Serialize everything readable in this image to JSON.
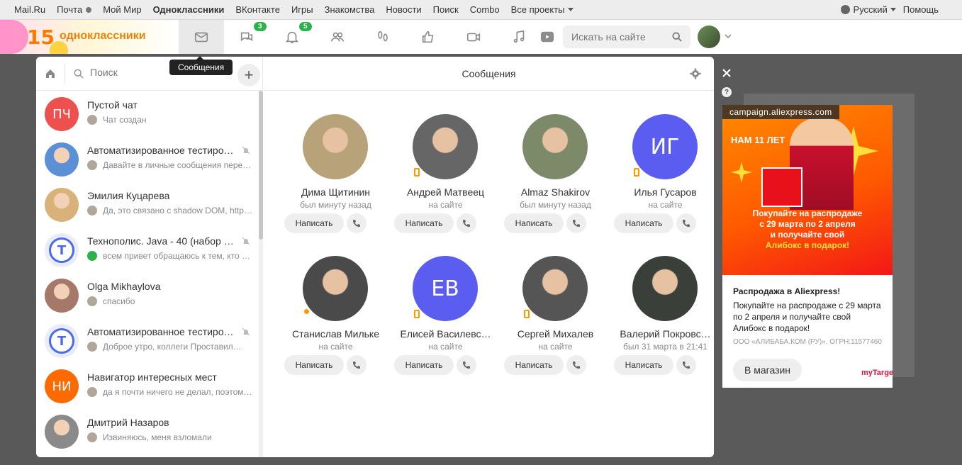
{
  "portal": {
    "links": [
      "Mail.Ru",
      "Почта",
      "Мой Мир",
      "Одноклассники",
      "ВКонтакте",
      "Игры",
      "Знакомства",
      "Новости",
      "Поиск",
      "Combo",
      "Все проекты"
    ],
    "language": "Русский",
    "help": "Помощь"
  },
  "logo": {
    "number": "15",
    "name": "одноклассники"
  },
  "toolbar": {
    "badges": {
      "discussions": "3",
      "notifications": "5"
    },
    "search_placeholder": "Искать на сайте"
  },
  "tooltip": "Сообщения",
  "sidebar": {
    "search_placeholder": "Поиск",
    "chats": [
      {
        "title": "Пустой чат",
        "sub": "Чат создан",
        "initials": "ПЧ",
        "color": "#ee4f4f",
        "muted": false
      },
      {
        "title": "Автоматизированное тестиро…",
        "sub": "Давайте в личные сообщения пере…",
        "initials": "",
        "color": "#5b8fd6",
        "muted": true
      },
      {
        "title": "Эмилия Куцарева",
        "sub": "Да, это связано с shadow DOM, https…",
        "initials": "",
        "color": "#d9b27a",
        "muted": false
      },
      {
        "title": "Технополис. Java - 40 (набор …",
        "sub": "всем привет обращаюсь к тем, кто …",
        "initials": "T",
        "color": "#4d6ae6",
        "muted": true
      },
      {
        "title": "Olga Mikhaylova",
        "sub": "спасибо",
        "initials": "",
        "color": "#a5786a",
        "muted": false
      },
      {
        "title": "Автоматизированное тестиро…",
        "sub": "Доброе утро, коллеги Проставил…",
        "initials": "T",
        "color": "#4d6ae6",
        "muted": true
      },
      {
        "title": "Навигатор интересных мест",
        "sub": "да я почти ничего не делал, поэтом…",
        "initials": "НИ",
        "color": "#ff6a00",
        "muted": false
      },
      {
        "title": "Дмитрий Назаров",
        "sub": "Извиняюсь, меня взломали",
        "initials": "",
        "color": "#8a8a8a",
        "muted": false
      }
    ]
  },
  "content": {
    "title": "Сообщения",
    "write_label": "Написать",
    "friends": [
      {
        "name": "Дима Щитинин",
        "status": "был минуту назад",
        "initials": "",
        "color": "#b7a27a",
        "indicator": "none"
      },
      {
        "name": "Андрей Матвеец",
        "status": "на сайте",
        "initials": "",
        "color": "#666666",
        "indicator": "phone"
      },
      {
        "name": "Almaz Shakirov",
        "status": "был минуту назад",
        "initials": "",
        "color": "#7c8a6a",
        "indicator": "none"
      },
      {
        "name": "Илья Гусаров",
        "status": "на сайте",
        "initials": "ИГ",
        "color": "#5b5cf0",
        "indicator": "phone"
      },
      {
        "name": "Станислав Мильке",
        "status": "на сайте",
        "initials": "",
        "color": "#4a4a4a",
        "indicator": "dot"
      },
      {
        "name": "Елисей Василевс…",
        "status": "на сайте",
        "initials": "ЕВ",
        "color": "#5b5cf0",
        "indicator": "phone"
      },
      {
        "name": "Сергей Михалев",
        "status": "на сайте",
        "initials": "",
        "color": "#555555",
        "indicator": "phone"
      },
      {
        "name": "Валерий Покровс…",
        "status": "был 31 марта в 21:41",
        "initials": "",
        "color": "#3a3f3a",
        "indicator": "none"
      }
    ]
  },
  "ad": {
    "domain": "campaign.aliexpress.com",
    "logo_text": "НАМ 11 ЛЕТ",
    "banner_line1": "Покупайте на распродаже",
    "banner_line2": "с 29 марта по 2 апреля",
    "banner_line3": "и получайте свой",
    "banner_line4": "Алибокс в подарок!",
    "heading": "Распродажа в Aliexpress!",
    "description": "Покупайте на распродаже с 29 марта по 2 апреля и получайте свой Алибокс в подарок!",
    "legal": "ООО «АЛИБАБА.КОМ (РУ)». ОГРН:11577460",
    "button": "В магазин",
    "mark": "myTarget"
  }
}
